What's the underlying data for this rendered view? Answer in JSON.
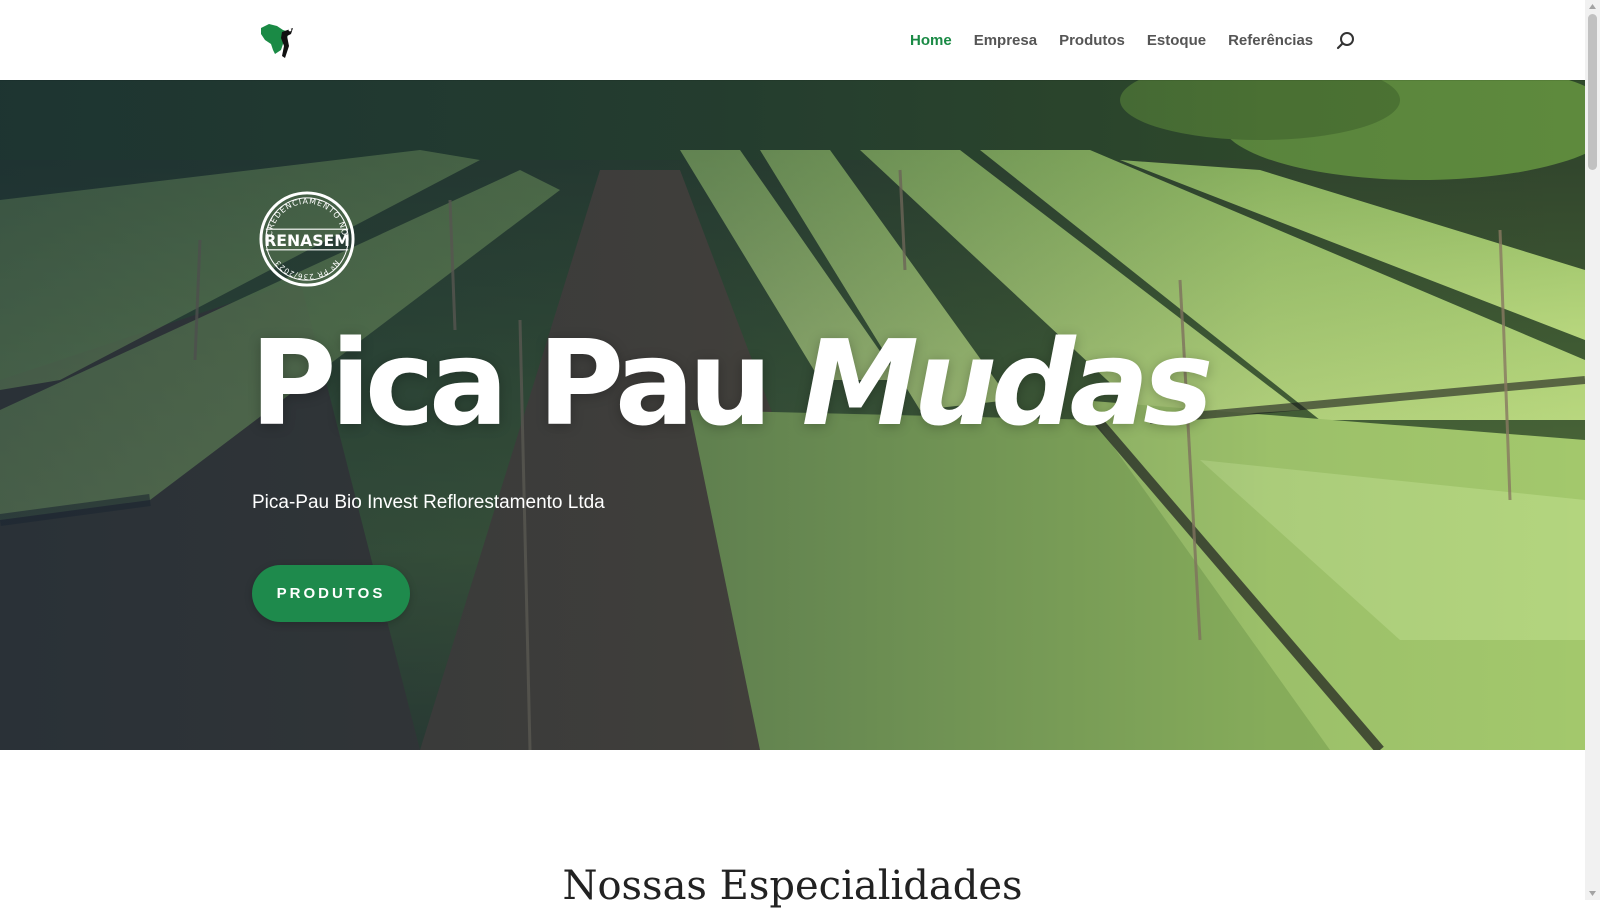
{
  "header": {
    "logo": {
      "icon": "brazil-map-woodpecker-icon",
      "color": "#1a8a45"
    },
    "nav": [
      {
        "label": "Home",
        "active": true
      },
      {
        "label": "Empresa",
        "active": false
      },
      {
        "label": "Produtos",
        "active": false
      },
      {
        "label": "Estoque",
        "active": false
      },
      {
        "label": "Referências",
        "active": false
      }
    ],
    "search_icon": "search-icon",
    "active_color": "#1a8a45"
  },
  "hero": {
    "stamp": {
      "top_text": "CREDENCIAMENTO NO",
      "main_text": "RENASEM",
      "bottom_text": "Nº PR 236/2023"
    },
    "title_part1": "Pica Pau",
    "title_part2": "Mudas",
    "subtitle": "Pica-Pau Bio Invest Reflorestamento Ltda",
    "cta_label": "PRODUTOS",
    "cta_color": "#1e8a4c"
  },
  "section": {
    "title": "Nossas Especialidades"
  }
}
